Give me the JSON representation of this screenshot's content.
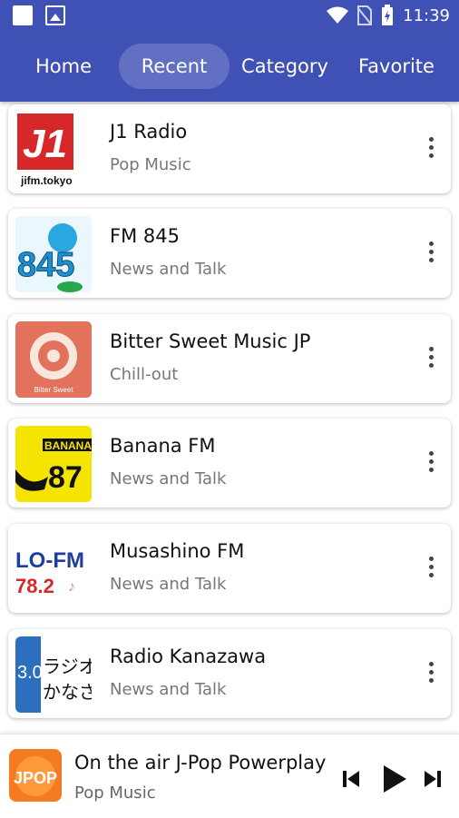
{
  "status_bar": {
    "time": "11:39",
    "icons": [
      "notification-square-icon",
      "image-icon",
      "wifi-icon",
      "no-sim-icon",
      "battery-charging-icon"
    ]
  },
  "tabs": [
    {
      "label": "Home",
      "active": false
    },
    {
      "label": "Recent",
      "active": true
    },
    {
      "label": "Category",
      "active": false
    },
    {
      "label": "Favorite",
      "active": false
    }
  ],
  "stations": [
    {
      "name": "J1 Radio",
      "genre": "Pop Music",
      "logo_text": "jifm.tokyo"
    },
    {
      "name": "FM 845",
      "genre": "News and Talk",
      "logo_text": "845"
    },
    {
      "name": "Bitter Sweet Music JP",
      "genre": "Chill-out",
      "logo_text": "Bitter Sweet"
    },
    {
      "name": "Banana FM",
      "genre": "News and Talk",
      "logo_text": "BANANA 87"
    },
    {
      "name": "Musashino FM",
      "genre": "News and Talk",
      "logo_text": "LO-FM 78.2"
    },
    {
      "name": "Radio Kanazawa",
      "genre": "News and Talk",
      "logo_text": "ラジオ かなざ"
    }
  ],
  "now_playing": {
    "title": "On the air J-Pop Powerplay",
    "genre": "Pop Music",
    "logo_text": "JPOP"
  },
  "colors": {
    "primary": "#3f51b5",
    "accent_red": "#d32f2f",
    "banana_yellow": "#f5e300"
  }
}
